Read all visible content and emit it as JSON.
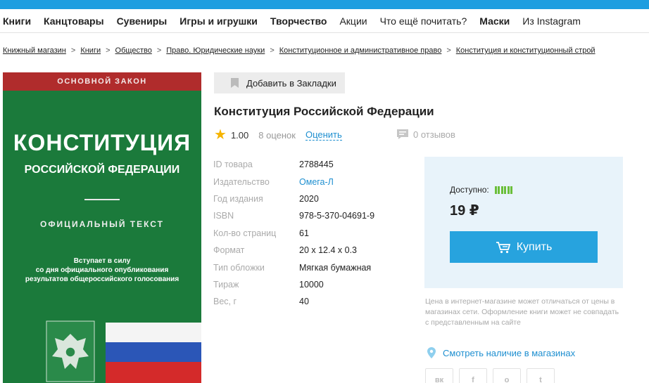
{
  "nav": {
    "items": [
      {
        "label": "Книги",
        "bold": true
      },
      {
        "label": "Канцтовары",
        "bold": true
      },
      {
        "label": "Сувениры",
        "bold": true
      },
      {
        "label": "Игры и игрушки",
        "bold": true
      },
      {
        "label": "Творчество",
        "bold": true
      },
      {
        "label": "Акции",
        "bold": false
      },
      {
        "label": "Что ещё почитать?",
        "bold": false
      },
      {
        "label": "Маски",
        "bold": true
      },
      {
        "label": "Из Instagram",
        "bold": false
      }
    ]
  },
  "breadcrumb": [
    "Книжный магазин",
    "Книги",
    "Общество",
    "Право. Юридические науки",
    "Конституционное и административное право",
    "Конституция и конституционный строй"
  ],
  "cover": {
    "band": "ОСНОВНОЙ ЗАКОН",
    "title": "КОНСТИТУЦИЯ",
    "subtitle": "РОССИЙСКОЙ ФЕДЕРАЦИИ",
    "official": "ОФИЦИАЛЬНЫЙ ТЕКСТ",
    "note_line1": "Вступает в силу",
    "note_line2": "со дня официального опубликования",
    "note_line3": "результатов общероссийского голосования"
  },
  "bookmark_label": "Добавить в Закладки",
  "product_title": "Конституция Российской Федерации",
  "rating": {
    "value": "1.00",
    "count": "8 оценок",
    "rate_label": "Оценить"
  },
  "reviews": "0 отзывов",
  "specs": [
    {
      "label": "ID товара",
      "value": "2788445"
    },
    {
      "label": "Издательство",
      "value": "Омега-Л"
    },
    {
      "label": "Год издания",
      "value": "2020"
    },
    {
      "label": "ISBN",
      "value": "978-5-370-04691-9"
    },
    {
      "label": "Кол-во страниц",
      "value": "61"
    },
    {
      "label": "Формат",
      "value": "20 x 12.4 x 0.3"
    },
    {
      "label": "Тип обложки",
      "value": "Мягкая бумажная"
    },
    {
      "label": "Тираж",
      "value": "10000"
    },
    {
      "label": "Вес, г",
      "value": "40"
    }
  ],
  "buy": {
    "availability_label": "Доступно:",
    "price": "19 ₽",
    "button_label": "Купить"
  },
  "disclaimer": "Цена в интернет-магазине может отличаться от цены в магазинах сети. Оформление книги может не совпадать с представленным на сайте",
  "stores_link": "Смотреть наличие в магазинах",
  "social": [
    "vk-icon",
    "facebook-icon",
    "odnoklassniki-icon",
    "twitter-icon"
  ],
  "colors": {
    "accent": "#27a3de",
    "topbar": "#1e9ee0",
    "star": "#f6b400",
    "availability": "#6bbf3a"
  }
}
